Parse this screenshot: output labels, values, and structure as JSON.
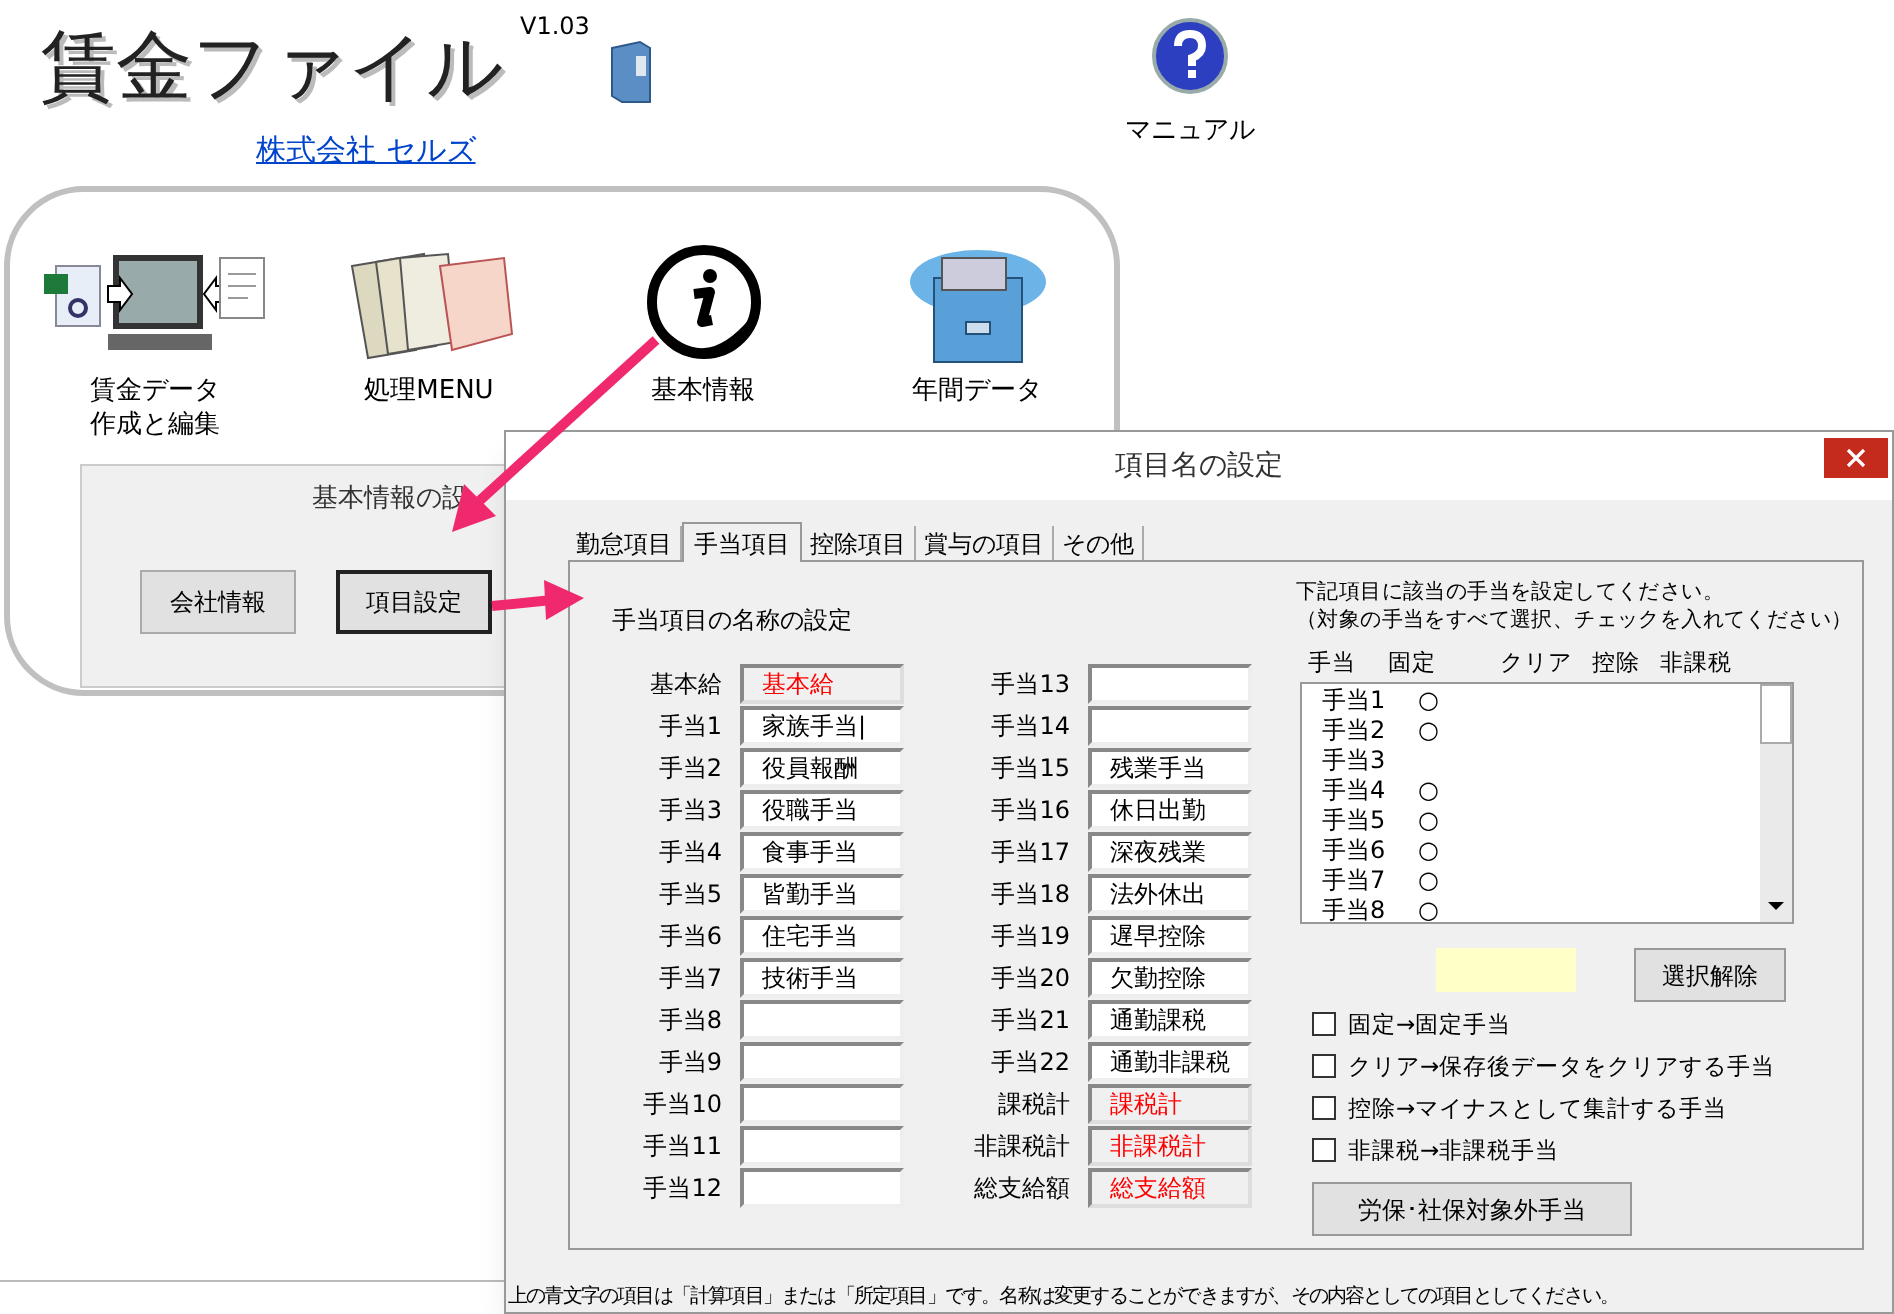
{
  "app": {
    "logo": "賃金ファイル",
    "version": "V1.03",
    "company_link": "株式会社 セルズ",
    "manual_label": "マニュアル"
  },
  "menu": [
    {
      "kind": "data",
      "lines": [
        "賃金データ",
        "作成と編集"
      ]
    },
    {
      "kind": "process",
      "lines": [
        "処理MENU"
      ]
    },
    {
      "kind": "info",
      "lines": [
        "基本情報"
      ]
    },
    {
      "kind": "annual",
      "lines": [
        "年間データ"
      ]
    }
  ],
  "basic_group": {
    "title": "基本情報の設",
    "buttons": [
      {
        "label": "会社情報",
        "focused": false
      },
      {
        "label": "項目設定",
        "focused": true
      }
    ]
  },
  "dialog": {
    "title": "項目名の設定",
    "tabs": [
      {
        "label": "勤怠項目",
        "selected": false
      },
      {
        "label": "手当項目",
        "selected": true
      },
      {
        "label": "控除項目",
        "selected": false
      },
      {
        "label": "賞与の項目",
        "selected": false
      },
      {
        "label": "その他",
        "selected": false
      }
    ],
    "heading": "手当項目の名称の設定",
    "fields": [
      {
        "label": "基本給",
        "value": "基本給",
        "kind": "calc"
      },
      {
        "label": "手当1",
        "value": "家族手当|",
        "kind": "input"
      },
      {
        "label": "手当2",
        "value": "役員報酬",
        "kind": "input"
      },
      {
        "label": "手当3",
        "value": "役職手当",
        "kind": "input"
      },
      {
        "label": "手当4",
        "value": "食事手当",
        "kind": "input"
      },
      {
        "label": "手当5",
        "value": "皆勤手当",
        "kind": "input"
      },
      {
        "label": "手当6",
        "value": "住宅手当",
        "kind": "input"
      },
      {
        "label": "手当7",
        "value": "技術手当",
        "kind": "input"
      },
      {
        "label": "手当8",
        "kind": "input"
      },
      {
        "label": "手当9",
        "kind": "input"
      },
      {
        "label": "手当10",
        "kind": "input"
      },
      {
        "label": "手当11",
        "kind": "input"
      },
      {
        "label": "手当12",
        "kind": "input"
      },
      {
        "label": "手当13",
        "kind": "input"
      },
      {
        "label": "手当14",
        "kind": "input"
      },
      {
        "label": "手当15",
        "value": "残業手当",
        "kind": "input"
      },
      {
        "label": "手当16",
        "value": "休日出勤",
        "kind": "input"
      },
      {
        "label": "手当17",
        "value": "深夜残業",
        "kind": "input"
      },
      {
        "label": "手当18",
        "value": "法外休出",
        "kind": "input"
      },
      {
        "label": "手当19",
        "value": "遅早控除",
        "kind": "input"
      },
      {
        "label": "手当20",
        "value": "欠勤控除",
        "kind": "input"
      },
      {
        "label": "手当21",
        "value": "通勤課税",
        "kind": "input"
      },
      {
        "label": "手当22",
        "value": "通勤非課税",
        "kind": "input"
      },
      {
        "label": "課税計",
        "value": "課税計",
        "kind": "calc"
      },
      {
        "label": "非課税計",
        "value": "非課税計",
        "kind": "calc"
      },
      {
        "label": "総支給額",
        "value": "総支給額",
        "kind": "calc"
      }
    ],
    "instructions": [
      "下記項目に該当の手当を設定してください。",
      "（対象の手当をすべて選択、チェックを入れてください）"
    ],
    "list_columns": [
      "手当",
      "固定",
      "クリア",
      "控除",
      "非課税"
    ],
    "list_rows": [
      {
        "allowance": "手当1",
        "fixed": "○"
      },
      {
        "allowance": "手当2",
        "fixed": "○"
      },
      {
        "allowance": "手当3"
      },
      {
        "allowance": "手当4",
        "fixed": "○"
      },
      {
        "allowance": "手当5",
        "fixed": "○"
      },
      {
        "allowance": "手当6",
        "fixed": "○"
      },
      {
        "allowance": "手当7",
        "fixed": "○"
      },
      {
        "allowance": "手当8",
        "fixed": "○"
      }
    ],
    "clear_button": "選択解除",
    "checkboxes": [
      {
        "label": "固定→固定手当",
        "checked": false
      },
      {
        "label": "クリア→保存後データをクリアする手当",
        "checked": false
      },
      {
        "label": "控除→マイナスとして集計する手当",
        "checked": false
      },
      {
        "label": "非課税→非課税手当",
        "checked": false
      }
    ],
    "exclude_button": "労保･社保対象外手当",
    "footer": "上の青文字の項目は「計算項目」または「所定項目」です。名称は変更することができますが、その内容としての項目としてください。"
  }
}
